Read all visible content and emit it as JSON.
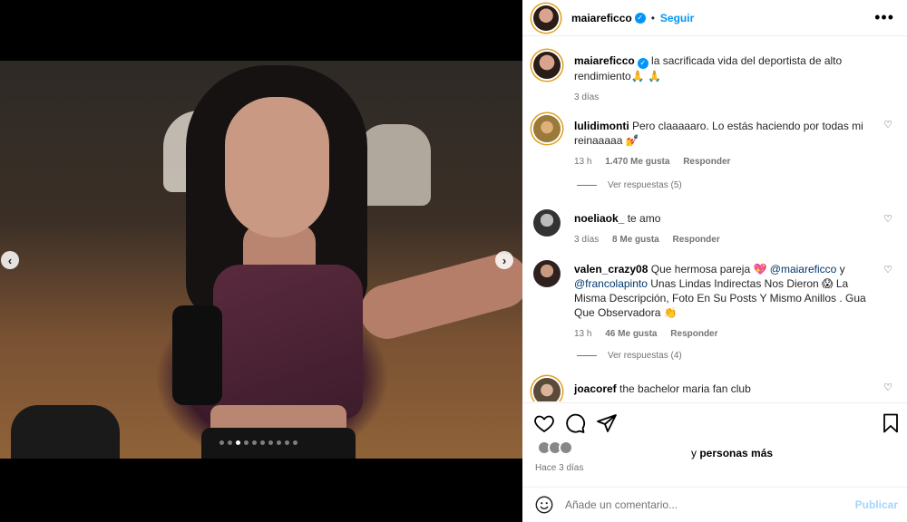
{
  "post": {
    "username": "maiareficco",
    "follow_label": "Seguir",
    "separator": "•",
    "more_label": "•••",
    "caption": "la sacrificada vida del deportista de alto rendimiento🙏 🙏",
    "caption_age": "3 días",
    "carousel": {
      "total": 10,
      "active_index": 3
    }
  },
  "comments": [
    {
      "username": "lulidimonti",
      "text": "Pero claaaaaro. Lo estás haciendo por todas mi reinaaaaa 💅",
      "age": "13 h",
      "likes": "1.470 Me gusta",
      "reply_label": "Responder",
      "view_replies": "Ver respuestas (5)"
    },
    {
      "username": "noeliaok_",
      "text": "te amo",
      "age": "3 días",
      "likes": "8 Me gusta",
      "reply_label": "Responder"
    },
    {
      "username": "valen_crazy08",
      "text_before": "Que hermosa pareja 💖",
      "mention1": "@maiareficco",
      "text_mid": "y",
      "mention2": "@francolapinto",
      "text_after": "Unas Lindas Indirectas Nos Dieron 😱 La Misma Descripción, Foto En Su Posts Y Mismo Anillos . Gua Que Observadora 👏",
      "age": "13 h",
      "likes": "46 Me gusta",
      "reply_label": "Responder",
      "view_replies": "Ver respuestas (4)"
    },
    {
      "username": "joacoref",
      "text": "the bachelor maria fan club"
    }
  ],
  "likes_summary": {
    "suffix": "y",
    "bold": "personas más"
  },
  "date": "Hace 3 días",
  "add_comment": {
    "placeholder": "Añade un comentario...",
    "publish_label": "Publicar"
  },
  "icons": [
    "heart-icon",
    "comment-icon",
    "share-icon",
    "bookmark-icon",
    "emoji-icon",
    "verified-icon",
    "chevron-left-icon",
    "chevron-right-icon"
  ],
  "colors": {
    "link": "#0095f6",
    "mention": "#00376b",
    "muted": "#737373",
    "publish_disabled": "#a5d6fb"
  }
}
